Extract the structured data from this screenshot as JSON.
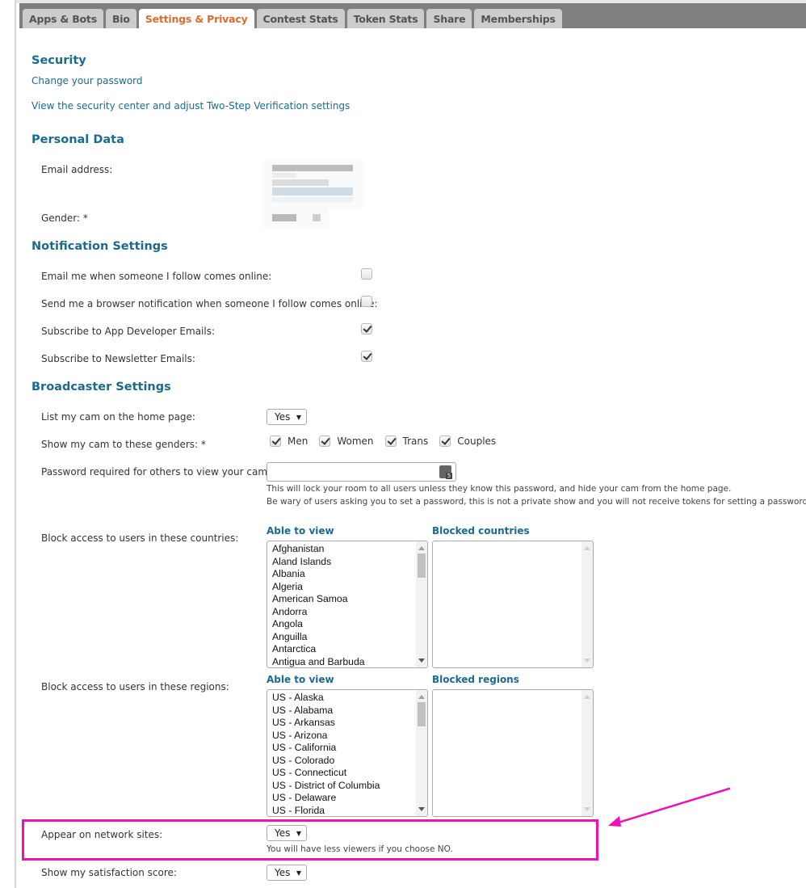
{
  "tabs": [
    {
      "label": "Apps & Bots",
      "active": false
    },
    {
      "label": "Bio",
      "active": false
    },
    {
      "label": "Settings & Privacy",
      "active": true
    },
    {
      "label": "Contest Stats",
      "active": false
    },
    {
      "label": "Token Stats",
      "active": false
    },
    {
      "label": "Share",
      "active": false
    },
    {
      "label": "Memberships",
      "active": false
    }
  ],
  "security": {
    "title": "Security",
    "change_password": "Change your password",
    "security_center": "View the security center and adjust Two-Step Verification settings"
  },
  "personal": {
    "title": "Personal Data",
    "email_label": "Email address:",
    "gender_label": "Gender: *"
  },
  "notifications": {
    "title": "Notification Settings",
    "items": [
      {
        "label": "Email me when someone I follow comes online:",
        "checked": false
      },
      {
        "label": "Send me a browser notification when someone I follow comes online:",
        "checked": false
      },
      {
        "label": "Subscribe to App Developer Emails:",
        "checked": true
      },
      {
        "label": "Subscribe to Newsletter Emails:",
        "checked": true
      }
    ]
  },
  "broadcaster": {
    "title": "Broadcaster Settings",
    "list_cam_label": "List my cam on the home page:",
    "list_cam_value": "Yes",
    "genders_label": "Show my cam to these genders: *",
    "genders": [
      {
        "label": "Men",
        "checked": true
      },
      {
        "label": "Women",
        "checked": true
      },
      {
        "label": "Trans",
        "checked": true
      },
      {
        "label": "Couples",
        "checked": true
      }
    ],
    "password_label": "Password required for others to view your cam:",
    "password_value": "",
    "password_help_1": "This will lock your room to all users unless they know this password, and hide your cam from the home page.",
    "password_help_2": "Be wary of users asking you to set a password, this is not a private show and you will not receive tokens for setting a password.",
    "countries_label": "Block access to users in these countries:",
    "countries_able_title": "Able to view",
    "countries_blocked_title": "Blocked countries",
    "countries_able": [
      "Afghanistan",
      "Aland Islands",
      "Albania",
      "Algeria",
      "American Samoa",
      "Andorra",
      "Angola",
      "Anguilla",
      "Antarctica",
      "Antigua and Barbuda"
    ],
    "countries_blocked": [],
    "regions_label": "Block access to users in these regions:",
    "regions_able_title": "Able to view",
    "regions_blocked_title": "Blocked regions",
    "regions_able": [
      "US - Alaska",
      "US - Alabama",
      "US - Arkansas",
      "US - Arizona",
      "US - California",
      "US - Colorado",
      "US - Connecticut",
      "US - District of Columbia",
      "US - Delaware",
      "US - Florida"
    ],
    "regions_blocked": [],
    "network_label": "Appear on network sites:",
    "network_value": "Yes",
    "network_help": "You will have less viewers if you choose NO.",
    "satisfaction_label": "Show my satisfaction score:",
    "satisfaction_value": "Yes"
  },
  "annotation": {
    "color": "#ee12b4"
  }
}
